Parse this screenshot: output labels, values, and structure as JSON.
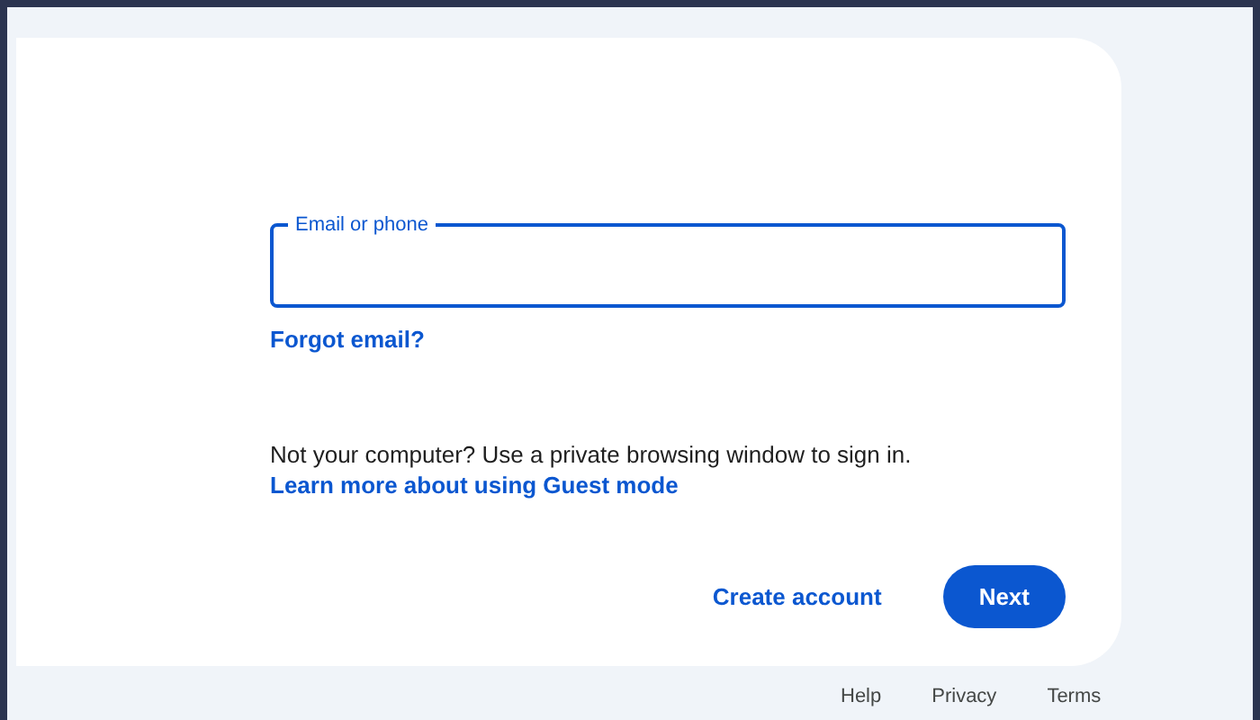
{
  "email_field": {
    "label": "Email or phone",
    "focused": true
  },
  "forgot_link": "Forgot email?",
  "guest_note": "Not your computer? Use a private browsing window to sign in.",
  "guest_link": "Learn more about using Guest mode",
  "buttons": {
    "secondary": "Create account",
    "primary": "Next"
  },
  "footer_links": [
    "Help",
    "Privacy",
    "Terms"
  ]
}
